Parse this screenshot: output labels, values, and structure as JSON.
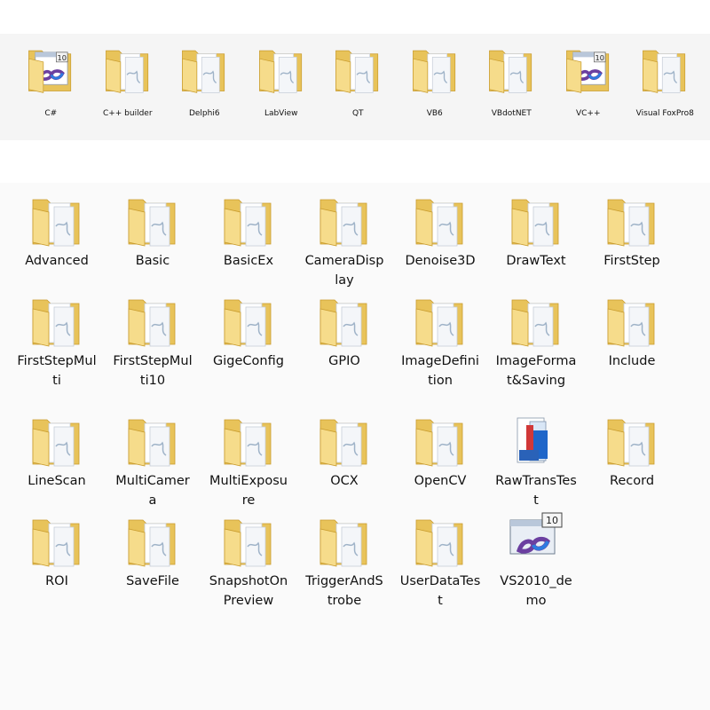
{
  "top_folders": [
    {
      "label": "C#",
      "icon": "vs2010-folder-icon"
    },
    {
      "label": "C++ builder",
      "icon": "folder-icon"
    },
    {
      "label": "Delphi6",
      "icon": "folder-icon"
    },
    {
      "label": "LabView",
      "icon": "folder-icon"
    },
    {
      "label": "QT",
      "icon": "folder-icon"
    },
    {
      "label": "VB6",
      "icon": "folder-icon"
    },
    {
      "label": "VBdotNET",
      "icon": "folder-icon"
    },
    {
      "label": "VC++",
      "icon": "vs2010-folder-icon"
    },
    {
      "label": "Visual FoxPro8",
      "icon": "folder-icon"
    }
  ],
  "main_items": [
    {
      "label": "Advanced",
      "icon": "folder-icon"
    },
    {
      "label": "Basic",
      "icon": "folder-icon"
    },
    {
      "label": "BasicEx",
      "icon": "folder-icon"
    },
    {
      "label": "CameraDisplay",
      "icon": "folder-icon"
    },
    {
      "label": "Denoise3D",
      "icon": "folder-icon"
    },
    {
      "label": "DrawText",
      "icon": "folder-icon"
    },
    {
      "label": "FirstStep",
      "icon": "folder-icon"
    },
    {
      "label": "FirstStepMulti",
      "icon": "folder-icon"
    },
    {
      "label": "FirstStepMulti10",
      "icon": "folder-icon"
    },
    {
      "label": "GigeConfig",
      "icon": "folder-icon"
    },
    {
      "label": "GPIO",
      "icon": "folder-icon"
    },
    {
      "label": "ImageDefinition",
      "icon": "folder-icon"
    },
    {
      "label": "ImageFormat&Saving",
      "icon": "folder-icon"
    },
    {
      "label": "Include",
      "icon": "folder-icon"
    },
    {
      "label": "LineScan",
      "icon": "folder-icon"
    },
    {
      "label": "MultiCamera",
      "icon": "folder-icon"
    },
    {
      "label": "MultiExposure",
      "icon": "folder-icon"
    },
    {
      "label": "OCX",
      "icon": "folder-icon"
    },
    {
      "label": "OpenCV",
      "icon": "folder-icon"
    },
    {
      "label": "RawTransTest",
      "icon": "app-icon"
    },
    {
      "label": "Record",
      "icon": "folder-icon"
    },
    {
      "label": "ROI",
      "icon": "folder-icon"
    },
    {
      "label": "SaveFile",
      "icon": "folder-icon"
    },
    {
      "label": "SnapshotOnPreview",
      "icon": "folder-icon"
    },
    {
      "label": "TriggerAndStrobe",
      "icon": "folder-icon"
    },
    {
      "label": "UserDataTest",
      "icon": "folder-icon"
    },
    {
      "label": "VS2010_demo",
      "icon": "vs2010-solution-icon"
    }
  ],
  "vs_badge": "10",
  "colors": {
    "folder_back": "#e8c35a",
    "folder_front": "#f6dc8b",
    "folder_edge": "#c99c2e",
    "paper": "#ffffff",
    "vs_purple": "#6b3fa0",
    "vs_blue": "#2d7be0"
  }
}
